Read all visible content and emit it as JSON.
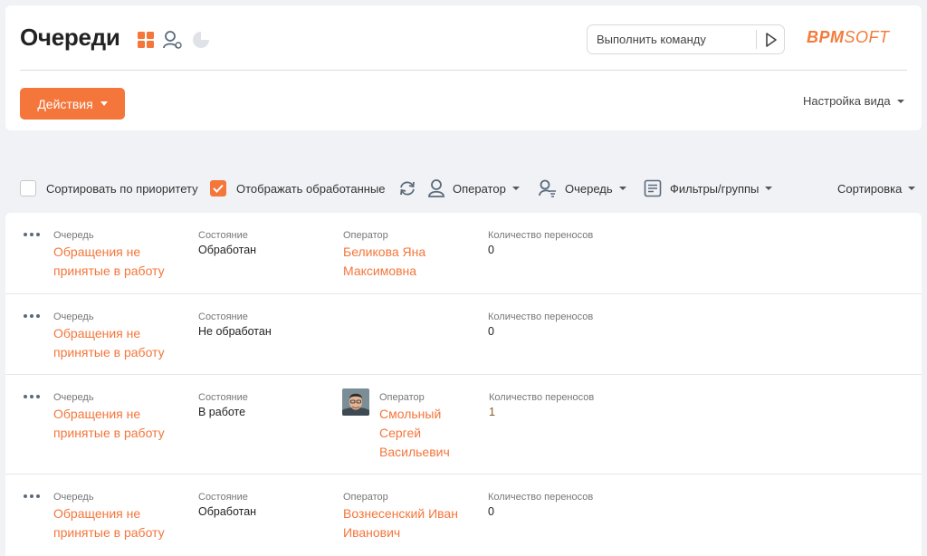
{
  "header": {
    "title": "Очереди",
    "command_placeholder": "Выполнить команду",
    "logo_bold": "BPM",
    "logo_thin": "SOFT",
    "actions_label": "Действия",
    "view_settings_label": "Настройка вида",
    "view_icons": [
      "grid-icon",
      "operator-settings-icon",
      "pie-chart-icon"
    ]
  },
  "toolbar": {
    "sort_priority_label": "Сортировать по приоритету",
    "sort_priority_checked": false,
    "show_processed_label": "Отображать обработанные",
    "show_processed_checked": true,
    "operator_label": "Оператор",
    "queue_label": "Очередь",
    "filters_label": "Фильтры/группы",
    "sorting_label": "Сортировка"
  },
  "colors": {
    "accent": "#f4763b",
    "background": "#f0f2f5"
  },
  "columns": {
    "queue": "Очередь",
    "state": "Состояние",
    "operator": "Оператор",
    "transfers": "Количество переносов"
  },
  "rows": [
    {
      "queue_l1": "Обращения не",
      "queue_l2": "принятые в работу",
      "state": "Обработан",
      "has_operator": true,
      "has_avatar": false,
      "op_l1": "Беликова Яна",
      "op_l2": "Максимовна",
      "op_l3": "",
      "transfers": "0"
    },
    {
      "queue_l1": "Обращения не",
      "queue_l2": "принятые в работу",
      "state": "Не обработан",
      "has_operator": false,
      "has_avatar": false,
      "op_l1": "",
      "op_l2": "",
      "op_l3": "",
      "transfers": "0"
    },
    {
      "queue_l1": "Обращения не",
      "queue_l2": "принятые в работу",
      "state": "В работе",
      "has_operator": true,
      "has_avatar": true,
      "op_l1": "Смольный",
      "op_l2": "Сергей",
      "op_l3": "Васильевич",
      "transfers": "1"
    },
    {
      "queue_l1": "Обращения не",
      "queue_l2": "принятые в работу",
      "state": "Обработан",
      "has_operator": true,
      "has_avatar": false,
      "op_l1": "Вознесенский Иван",
      "op_l2": "Иванович",
      "op_l3": "",
      "transfers": "0"
    }
  ]
}
